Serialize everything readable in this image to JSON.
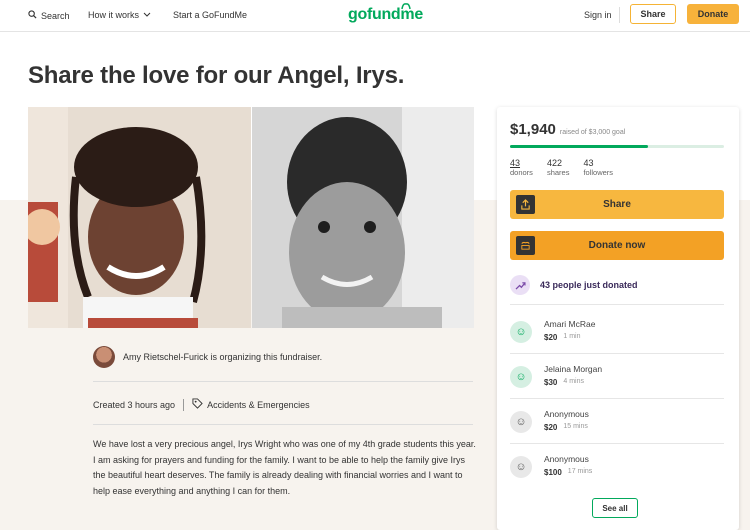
{
  "nav": {
    "search_label": "Search",
    "how_it_works_label": "How it works",
    "start_label": "Start a GoFundMe",
    "logo_text": "gofundme",
    "signin_label": "Sign in",
    "share_label": "Share",
    "donate_label": "Donate"
  },
  "campaign": {
    "title": "Share the love for our Angel, Irys.",
    "organizer_text": "Amy Rietschel-Furick is organizing this fundraiser.",
    "created_text": "Created 3 hours ago",
    "category": "Accidents & Emergencies",
    "description": "We have lost a very precious angel, Irys Wright who was one of my 4th grade students this year. I am asking for prayers and funding for the family. I want to be able to help the family give Irys the beautiful heart deserves. The family is already dealing with financial worries and I want to help ease everything and anything I can for them."
  },
  "sidebar": {
    "raised_amount": "$1,940",
    "goal_text": "raised of $3,000 goal",
    "progress_fraction": 0.647,
    "stats": [
      {
        "num": "43",
        "label": "donors"
      },
      {
        "num": "422",
        "label": "shares"
      },
      {
        "num": "43",
        "label": "followers"
      }
    ],
    "share_button": "Share",
    "donate_button": "Donate now",
    "just_donated": "43 people just donated",
    "donations": [
      {
        "name": "Amari McRae",
        "amount": "$20",
        "time": "1 min",
        "avatar": "green"
      },
      {
        "name": "Jelaina Morgan",
        "amount": "$30",
        "time": "4 mins",
        "avatar": "green"
      },
      {
        "name": "Anonymous",
        "amount": "$20",
        "time": "15 mins",
        "avatar": "gray"
      },
      {
        "name": "Anonymous",
        "amount": "$100",
        "time": "17 mins",
        "avatar": "gray"
      }
    ],
    "see_all": "See all"
  },
  "colors": {
    "brand_green": "#02a95c",
    "button_yellow": "#f7b73f",
    "button_orange": "#f3a125"
  }
}
